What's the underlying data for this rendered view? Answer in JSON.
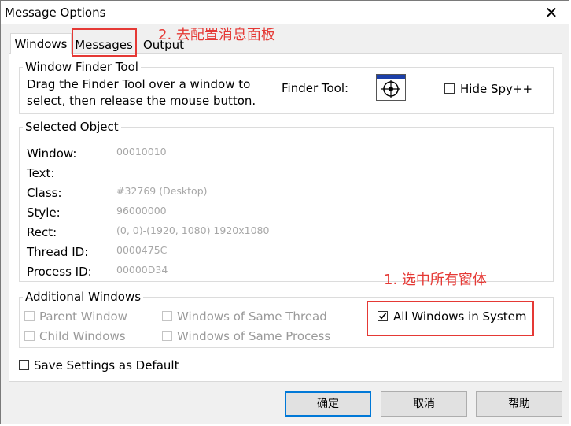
{
  "window": {
    "title": "Message Options",
    "close_glyph": "✕"
  },
  "tabs": [
    {
      "label": "Windows",
      "selected": true
    },
    {
      "label": "Messages",
      "selected": false
    },
    {
      "label": "Output",
      "selected": false
    }
  ],
  "finder": {
    "group_label": "Window Finder Tool",
    "instructions_line1": "Drag the Finder Tool over a window to",
    "instructions_line2": "select, then release the mouse button.",
    "tool_label": "Finder Tool:",
    "tool_icon": "crosshair-finder-icon",
    "hide_spy_label": "Hide Spy++",
    "hide_spy_checked": false
  },
  "selected_object": {
    "group_label": "Selected Object",
    "rows": [
      {
        "label": "Window:",
        "value": "00010010"
      },
      {
        "label": "Text:",
        "value": ""
      },
      {
        "label": "Class:",
        "value": "#32769 (Desktop)"
      },
      {
        "label": "Style:",
        "value": "96000000"
      },
      {
        "label": "Rect:",
        "value": "(0, 0)-(1920, 1080) 1920x1080"
      },
      {
        "label": "Thread ID:",
        "value": "0000475C"
      },
      {
        "label": "Process ID:",
        "value": "00000D34"
      }
    ]
  },
  "additional_windows": {
    "group_label": "Additional Windows",
    "parent_window": "Parent Window",
    "child_windows": "Child Windows",
    "same_thread": "Windows of Same Thread",
    "same_process": "Windows of Same Process",
    "all_windows": "All Windows in System",
    "all_windows_checked": true
  },
  "save_settings": {
    "label": "Save Settings as Default",
    "checked": false
  },
  "buttons": {
    "ok": "确定",
    "cancel": "取消",
    "help": "帮助"
  },
  "annotations": {
    "step1": "1. 选中所有窗体",
    "step2": "2. 去配置消息面板",
    "color": "#e53935"
  },
  "colors": {
    "accent": "#0078d7",
    "annotation_red": "#e53935"
  }
}
